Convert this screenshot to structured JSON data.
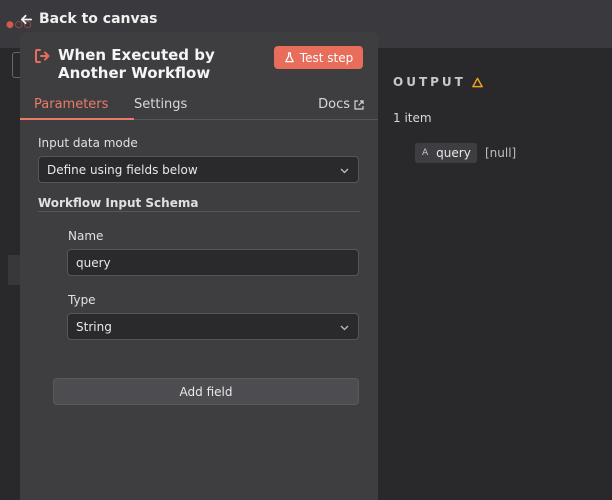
{
  "nav": {
    "back_label": "Back to canvas"
  },
  "panel": {
    "title": "When Executed by Another Workflow",
    "test_step_label": "Test step",
    "tabs": [
      {
        "label": "Parameters",
        "active": true
      },
      {
        "label": "Settings",
        "active": false
      }
    ],
    "docs_label": "Docs",
    "input_mode": {
      "label": "Input data mode",
      "value": "Define using fields below"
    },
    "schema": {
      "title": "Workflow Input Schema",
      "name_label": "Name",
      "name_value": "query",
      "type_label": "Type",
      "type_value": "String"
    },
    "add_field_label": "Add field"
  },
  "output": {
    "title": "OUTPUT",
    "item_count": "1 item",
    "fields": [
      {
        "type_badge": "A",
        "name": "query",
        "value": "[null]"
      }
    ]
  },
  "colors": {
    "accent": "#e86d5b",
    "tab_active": "#ea7b66",
    "warning": "#f0a020",
    "panel_bg": "#3e3e41",
    "page_bg": "#29292b"
  },
  "icons": {
    "back": "arrow-left-icon",
    "node": "sign-in-arrow-icon",
    "test": "flask-icon",
    "docs": "external-link-icon",
    "dropdown": "chevron-down-icon",
    "warning": "warning-triangle-icon"
  }
}
